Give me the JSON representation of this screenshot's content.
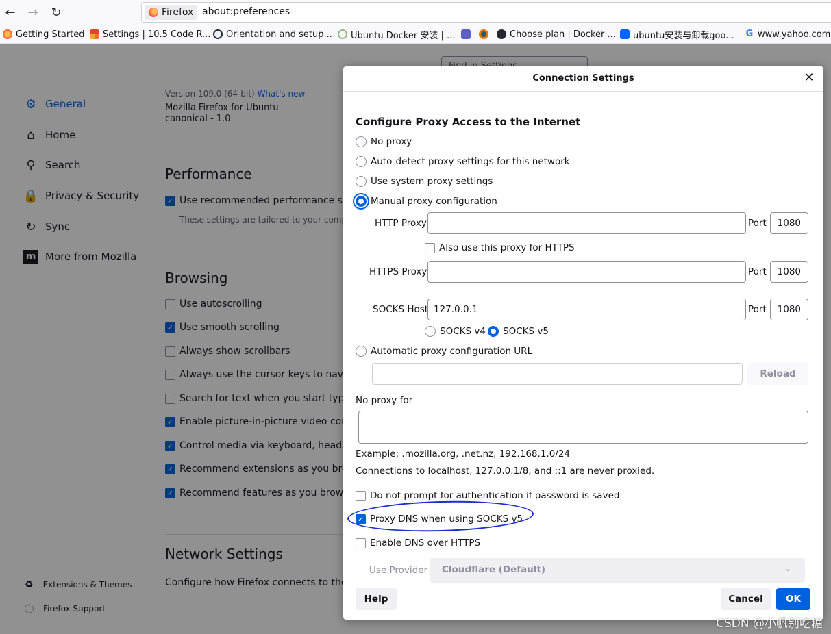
{
  "browser": {
    "identity_label": "Firefox",
    "url": "about:preferences",
    "bookmarks": [
      {
        "label": "Getting Started",
        "icon": "firefox-icon",
        "color": "#ff7139"
      },
      {
        "label": "Settings | 10.5 Code R...",
        "icon": "grid-icon",
        "color": "#e24329"
      },
      {
        "label": "Orientation and setup...",
        "icon": "docker-globe-icon",
        "color": "#2496ed"
      },
      {
        "label": "Ubuntu Docker 安装 | ...",
        "icon": "runoob-icon",
        "color": "#96b97d"
      },
      {
        "label": "",
        "icon": "teams-icon",
        "color": "#5b5fc7"
      },
      {
        "label": "",
        "icon": "blender-icon",
        "color": "#ea7600"
      },
      {
        "label": "Choose plan | Docker ...",
        "icon": "github-icon",
        "color": "#24292f"
      },
      {
        "label": "ubuntu安装与卸载goo...",
        "icon": "zhihu-icon",
        "color": "#0066ff"
      },
      {
        "label": "www.yahoo.com.",
        "icon": "google-icon",
        "color": "#4285f4"
      }
    ]
  },
  "settings_page": {
    "search_placeholder": "Find in Settings",
    "nav": [
      {
        "label": "General",
        "icon": "gear-icon",
        "active": true
      },
      {
        "label": "Home",
        "icon": "home-icon",
        "active": false
      },
      {
        "label": "Search",
        "icon": "search-icon",
        "active": false
      },
      {
        "label": "Privacy & Security",
        "icon": "lock-icon",
        "active": false
      },
      {
        "label": "Sync",
        "icon": "sync-icon",
        "active": false
      },
      {
        "label": "More from Mozilla",
        "icon": "mozilla-icon",
        "active": false
      }
    ],
    "footer_links": [
      {
        "label": "Extensions & Themes",
        "icon": "puzzle-icon"
      },
      {
        "label": "Firefox Support",
        "icon": "help-icon"
      }
    ],
    "version_line": "Version 109.0 (64-bit)",
    "whats_new": "What's new",
    "build_line1": "Mozilla Firefox for Ubuntu",
    "build_line2": "canonical - 1.0",
    "performance_title": "Performance",
    "performance_checkbox": "Use recommended performance settings",
    "performance_note": "These settings are tailored to your computer's hardware",
    "browsing_title": "Browsing",
    "browsing_items": [
      {
        "label": "Use autoscrolling",
        "checked": false
      },
      {
        "label": "Use smooth scrolling",
        "checked": true
      },
      {
        "label": "Always show scrollbars",
        "checked": false
      },
      {
        "label": "Always use the cursor keys to navigate",
        "checked": false
      },
      {
        "label": "Search for text when you start typing",
        "checked": false
      },
      {
        "label": "Enable picture-in-picture video controls",
        "checked": true
      },
      {
        "label": "Control media via keyboard, headset, or",
        "checked": true
      },
      {
        "label": "Recommend extensions as you browse",
        "checked": true
      },
      {
        "label": "Recommend features as you browse",
        "checked": true
      }
    ],
    "network_title": "Network Settings",
    "network_desc": "Configure how Firefox connects to the internet"
  },
  "dialog": {
    "title": "Connection Settings",
    "heading": "Configure Proxy Access to the Internet",
    "proxy_options": [
      {
        "label": "No proxy",
        "checked": false
      },
      {
        "label": "Auto-detect proxy settings for this network",
        "checked": false
      },
      {
        "label": "Use system proxy settings",
        "checked": false
      },
      {
        "label": "Manual proxy configuration",
        "checked": true
      }
    ],
    "http_proxy_label": "HTTP Proxy",
    "http_proxy_value": "",
    "http_port_label": "Port",
    "http_port_value": "1080",
    "also_https_label": "Also use this proxy for HTTPS",
    "also_https_checked": false,
    "https_proxy_label": "HTTPS Proxy",
    "https_proxy_value": "",
    "https_port_label": "Port",
    "https_port_value": "1080",
    "socks_host_label": "SOCKS Host",
    "socks_host_value": "127.0.0.1",
    "socks_port_label": "Port",
    "socks_port_value": "1080",
    "socks_v4_label": "SOCKS v4",
    "socks_v5_label": "SOCKS v5",
    "socks_version_selected": "v5",
    "auto_url_label": "Automatic proxy configuration URL",
    "auto_url_value": "",
    "reload_label": "Reload",
    "no_proxy_label": "No proxy for",
    "no_proxy_value": "",
    "example_text": "Example: .mozilla.org, .net.nz, 192.168.1.0/24",
    "localhost_text": "Connections to localhost, 127.0.0.1/8, and ::1 are never proxied.",
    "no_prompt_label": "Do not prompt for authentication if password is saved",
    "no_prompt_checked": false,
    "proxy_dns_label": "Proxy DNS when using SOCKS v5",
    "proxy_dns_checked": true,
    "doh_label": "Enable DNS over HTTPS",
    "doh_checked": false,
    "provider_label": "Use Provider",
    "provider_value": "Cloudflare (Default)",
    "help_label": "Help",
    "cancel_label": "Cancel",
    "ok_label": "OK",
    "accent_color": "#0061e0"
  },
  "watermark": "CSDN @小帆别吃糖"
}
